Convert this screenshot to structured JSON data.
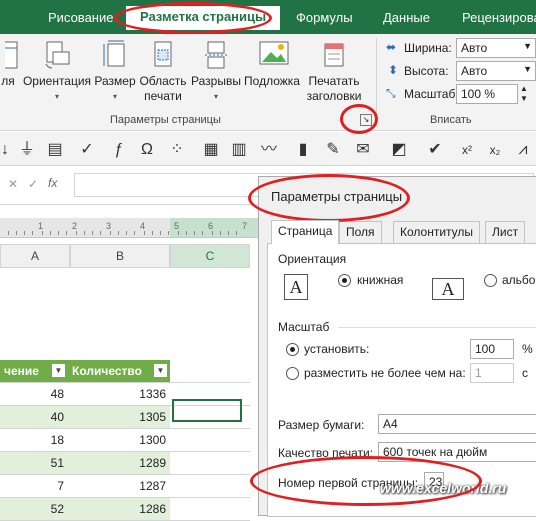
{
  "ribbon_tabs": [
    "Рисование",
    "Разметка страницы",
    "Формулы",
    "Данные",
    "Рецензирова"
  ],
  "ribbon": {
    "buttons": {
      "fields_cut": "ля",
      "orientation": "Ориентация",
      "size": "Размер",
      "print_area_l1": "Область",
      "print_area_l2": "печати",
      "breaks": "Разрывы",
      "background": "Подложка",
      "print_titles_l1": "Печатать",
      "print_titles_l2": "заголовки"
    },
    "group_page_setup": "Параметры страницы",
    "group_fit": "Вписать",
    "fit": {
      "width_label": "Ширина:",
      "width_value": "Авто",
      "height_label": "Высота:",
      "height_value": "Авто",
      "scale_label": "Масштаб:",
      "scale_value": "100 %"
    }
  },
  "formula_bar": {
    "fx": "fx"
  },
  "columns": [
    "A",
    "B",
    "C"
  ],
  "table": {
    "headers": [
      "чение",
      "Количество"
    ],
    "rows": [
      [
        "48",
        "1336"
      ],
      [
        "40",
        "1305"
      ],
      [
        "18",
        "1300"
      ],
      [
        "51",
        "1289"
      ],
      [
        "7",
        "1287"
      ],
      [
        "52",
        "1286"
      ]
    ]
  },
  "dialog": {
    "title": "Параметры страницы",
    "tabs": [
      "Страница",
      "Поля",
      "Колонтитулы",
      "Лист"
    ],
    "orientation_label": "Ориентация",
    "portrait": "книжная",
    "landscape": "альбом",
    "scale_label": "Масштаб",
    "set_label": "установить:",
    "set_value": "100",
    "set_unit": "% с",
    "fit_label": "разместить не более чем на:",
    "fit_value": "1",
    "fit_unit": "с",
    "paper_size_label": "Размер бумаги:",
    "paper_size_value": "A4",
    "print_quality_label": "Качество печати:",
    "print_quality_value": "600 точек на дюйм",
    "first_page_label": "Номер первой страницы:",
    "first_page_value": "23",
    "glyph": "A"
  },
  "watermark": "www.excelworld.ru",
  "colors": {
    "excel_green": "#217346",
    "table_header": "#70ad47",
    "annotation": "#e02020"
  }
}
